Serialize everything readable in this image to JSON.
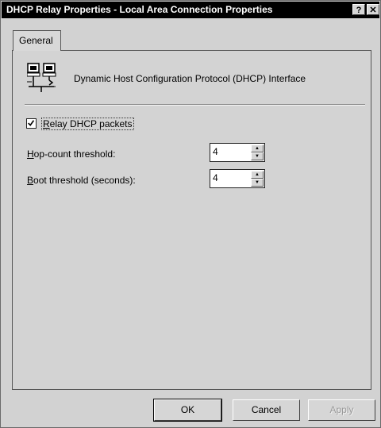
{
  "window": {
    "title": "DHCP Relay Properties - Local Area Connection Properties",
    "help_glyph": "?",
    "close_glyph": "✕"
  },
  "tabs": [
    {
      "label": "General",
      "selected": true
    }
  ],
  "general": {
    "interface_label": "Dynamic Host Configuration Protocol (DHCP) Interface",
    "relay_checkbox": {
      "mnemonic": "R",
      "rest": "elay DHCP packets",
      "checked": true,
      "check_glyph": "✓"
    },
    "hop_count": {
      "mnemonic": "H",
      "rest": "op-count threshold:",
      "value": "4"
    },
    "boot_threshold": {
      "mnemonic": "B",
      "rest": "oot threshold (seconds):",
      "value": "4"
    },
    "spin_up_glyph": "▲",
    "spin_down_glyph": "▼"
  },
  "buttons": {
    "ok": "OK",
    "cancel": "Cancel",
    "apply": "Apply",
    "apply_enabled": false
  }
}
